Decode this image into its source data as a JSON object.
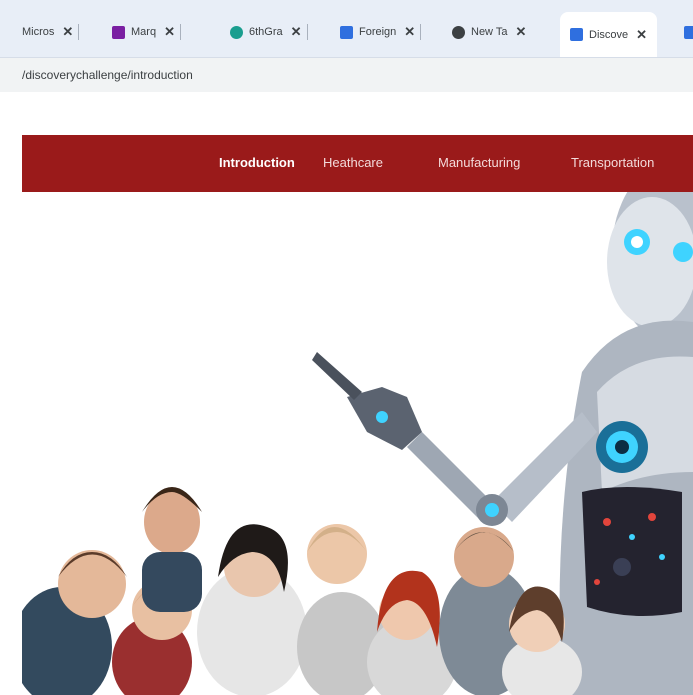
{
  "browser": {
    "tabs": [
      {
        "label": "Micros"
      },
      {
        "label": "Marq"
      },
      {
        "label": "6thGra"
      },
      {
        "label": "Foreign"
      },
      {
        "label": "New Ta"
      },
      {
        "label": "Discove"
      }
    ],
    "address": "/discoverychallenge/introduction"
  },
  "site": {
    "nav": [
      {
        "label": "Introduction"
      },
      {
        "label": "Heathcare"
      },
      {
        "label": "Manufacturing"
      },
      {
        "label": "Transportation"
      }
    ]
  },
  "colors": {
    "nav_bg": "#9a1a1a",
    "tabbar_bg": "#e8eef7",
    "robot_accent": "#3fd3ff"
  },
  "icons": [
    "close-icon",
    "marq-icon",
    "6thgrade-icon",
    "foreign-icon",
    "chrome-icon",
    "discovery-icon"
  ]
}
